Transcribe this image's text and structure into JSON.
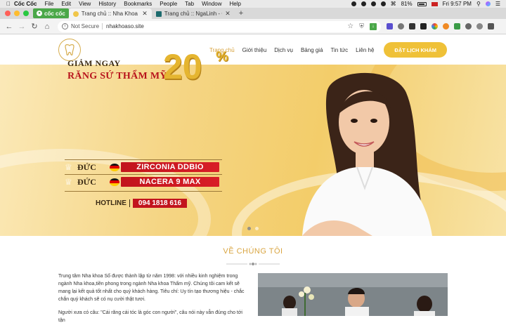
{
  "menubar": {
    "app": "Cốc Cốc",
    "items": [
      "File",
      "Edit",
      "View",
      "History",
      "Bookmarks",
      "People",
      "Tab",
      "Window",
      "Help"
    ],
    "battery": "81%",
    "clock": "Fri 9:57 PM"
  },
  "browser": {
    "brand": "cốc cốc",
    "tabs": [
      {
        "title": "Trang chủ :: Nha Khoa Thẩm"
      },
      {
        "title": "Trang chủ :: NgaLinh - Chuy..."
      }
    ],
    "new_tab": "+",
    "not_secure": "Not Secure",
    "url": "nhakhoaso.site"
  },
  "site": {
    "nav": [
      "Trang chủ",
      "Giới thiệu",
      "Dịch vụ",
      "Bảng giá",
      "Tin tức",
      "Liên hệ"
    ],
    "cta": "ĐẶT LỊCH KHÁM"
  },
  "hero": {
    "promo_line1": "GIẢM NGAY",
    "promo_line2": "RĂNG SỨ THẨM MỸ",
    "discount": "20",
    "percent_sign": "%",
    "products": [
      {
        "origin": "ĐỨC",
        "name": "ZIRCONIA DDBIO"
      },
      {
        "origin": "ĐỨC",
        "name": "NACERA 9 MAX"
      }
    ],
    "hotline_label": "HOTLINE",
    "hotline_phone": "094 1818 616",
    "slide_count": 2,
    "active_slide": 1
  },
  "about": {
    "title": "VỀ CHÚNG TÔI",
    "para1": "Trung tâm Nha khoa Số được thành lập từ năm 1998: với nhiều kinh nghiệm trong ngành Nha khoa,tiền phong trong ngành Nha khoa Thẩm mỹ. Chúng tôi cam kết sẽ mang lại kết quả tốt nhất cho quý khách hàng. Tiêu chí: Uy tín tạo thương hiệu - chắc chắn quý khách sẽ có nụ cười thật tươi.",
    "para2": "Người xưa có câu: \"Cái răng cái tóc là góc con người\", câu nói này vẫn đúng cho tới tận"
  }
}
